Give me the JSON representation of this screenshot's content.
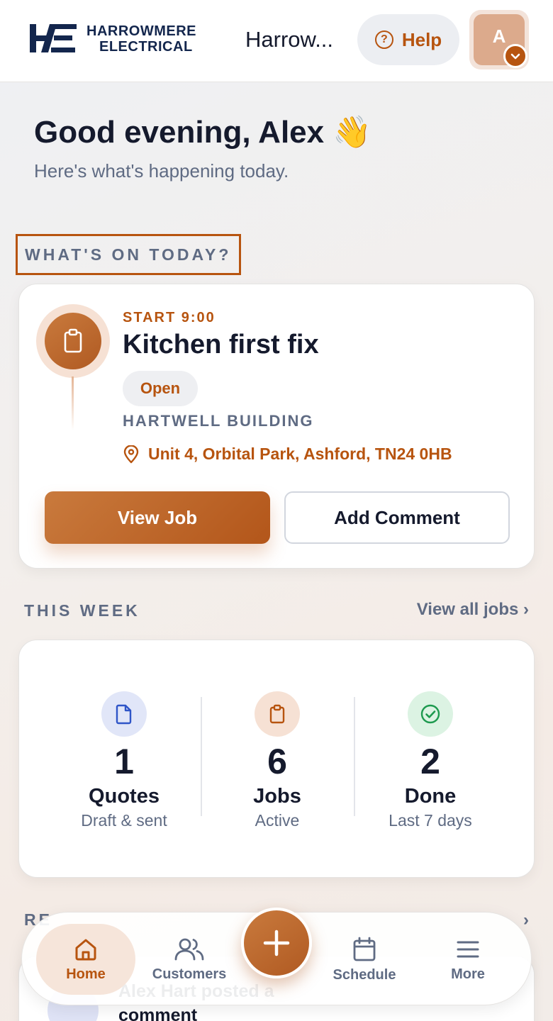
{
  "header": {
    "brand_line1": "HARROWMERE",
    "brand_line2": "ELECTRICAL",
    "company_name": "Harrow...",
    "help_label": "Help",
    "avatar_initial": "A"
  },
  "greeting": {
    "title": "Good evening, Alex 👋",
    "subtitle": "Here's what's happening today."
  },
  "today": {
    "section_label": "WHAT'S ON TODAY?",
    "job": {
      "start": "START 9:00",
      "title": "Kitchen first fix",
      "status": "Open",
      "client": "HARTWELL BUILDING",
      "address": "Unit 4, Orbital Park, Ashford, TN24 0HB",
      "primary_action": "View Job",
      "secondary_action": "Add Comment"
    }
  },
  "week": {
    "section_label": "THIS WEEK",
    "view_all": "View all jobs ›",
    "stats": [
      {
        "value": "1",
        "label": "Quotes",
        "sub": "Draft & sent"
      },
      {
        "value": "6",
        "label": "Jobs",
        "sub": "Active"
      },
      {
        "value": "2",
        "label": "Done",
        "sub": "Last 7 days"
      }
    ]
  },
  "recent": {
    "section_label": "RE",
    "link": "›",
    "activity_text": "Alex Hart posted a comment"
  },
  "nav": {
    "home": "Home",
    "customers": "Customers",
    "schedule": "Schedule",
    "more": "More"
  },
  "colors": {
    "accent": "#b7540f",
    "navy": "#13264d",
    "muted": "#5f6b83",
    "success": "#1e9a4f"
  }
}
